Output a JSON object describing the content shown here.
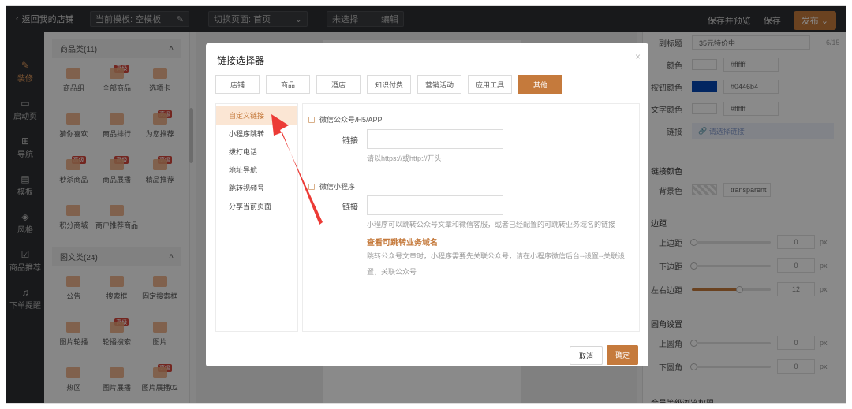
{
  "topbar": {
    "back_label": "返回我的店铺",
    "template_label": "当前模板: 空模板",
    "page_label": "切换页面: 首页",
    "unselected_label": "未选择",
    "edit_label": "编辑",
    "save_preview_label": "保存并预览",
    "save_label": "保存",
    "publish_label": "发布"
  },
  "rail": {
    "items": [
      {
        "label": "装修",
        "icon": "brush-icon",
        "glyph": "✎"
      },
      {
        "label": "启动页",
        "icon": "launch-icon",
        "glyph": "▭"
      },
      {
        "label": "导航",
        "icon": "grid-icon",
        "glyph": "⊞"
      },
      {
        "label": "模板",
        "icon": "template-icon",
        "glyph": "▤"
      },
      {
        "label": "风格",
        "icon": "style-icon",
        "glyph": "◈"
      },
      {
        "label": "商品推荐",
        "icon": "recommend-icon",
        "glyph": "☑"
      },
      {
        "label": "下单提醒",
        "icon": "bell-icon",
        "glyph": "♫"
      }
    ]
  },
  "components": {
    "group1_title": "商品类(11)",
    "group1_items": [
      "商品组",
      "全部商品",
      "选项卡",
      "猜你喜欢",
      "商品排行",
      "为您推荐",
      "秒杀商品",
      "商品展播",
      "精品推荐",
      "积分商城",
      "商户推荐商品"
    ],
    "group2_title": "图文类(24)",
    "group2_items": [
      "公告",
      "搜索框",
      "固定搜索框",
      "图片轮播",
      "轮播搜索",
      "图片",
      "热区",
      "图片展播",
      "图片展播02"
    ],
    "hot_badge": "高级"
  },
  "props": {
    "subtitle_label": "副标题",
    "subtitle_value": "35元特价中",
    "subtitle_count": "6/15",
    "color_label": "颜色",
    "color_value": "#ffffff",
    "btn_color_label": "按钮颜色",
    "btn_color_value": "#0446b4",
    "text_color_label": "文字颜色",
    "text_color_value": "#ffffff",
    "link_label": "链接",
    "link_placeholder": "请选择链接",
    "bg_section": "链接颜色",
    "bg_label": "背景色",
    "bg_value": "transparent",
    "margin_section": "边距",
    "top_margin_label": "上边距",
    "top_margin_value": "0",
    "bottom_margin_label": "下边距",
    "bottom_margin_value": "0",
    "lr_margin_label": "左右边距",
    "lr_margin_value": "12",
    "unit": "px",
    "radius_section": "圆角设置",
    "top_radius_label": "上圆角",
    "top_radius_value": "0",
    "bottom_radius_label": "下圆角",
    "bottom_radius_value": "0",
    "member_section": "会员等级浏览权限",
    "lr_margin_fill": 0.6
  },
  "modal": {
    "title": "链接选择器",
    "close": "×",
    "tabs": [
      "店铺",
      "商品",
      "酒店",
      "知识付费",
      "营销活动",
      "应用工具",
      "其他"
    ],
    "list": [
      "自定义链接",
      "小程序跳转",
      "拨打电话",
      "地址导航",
      "跳转视频号",
      "分享当前页面"
    ],
    "wechat_section": "微信公众号/H5/APP",
    "link_label": "链接",
    "hint1": "请以https://或http://开头",
    "mini_section": "微信小程序",
    "hint2": "小程序可以跳转公众号文章和微信客服，或者已经配置的可跳转业务域名的链接",
    "view_link": "查看可跳转业务域名",
    "hint3": "跳转公众号文章时，小程序需要先关联公众号，请在小程序微信后台--设置--关联设",
    "hint4": "置，关联公众号",
    "cancel": "取消",
    "confirm": "确定"
  },
  "colors": {
    "accent": "#c57a3c",
    "arrow": "#ec3b36",
    "btn_color": "#0446b4"
  }
}
